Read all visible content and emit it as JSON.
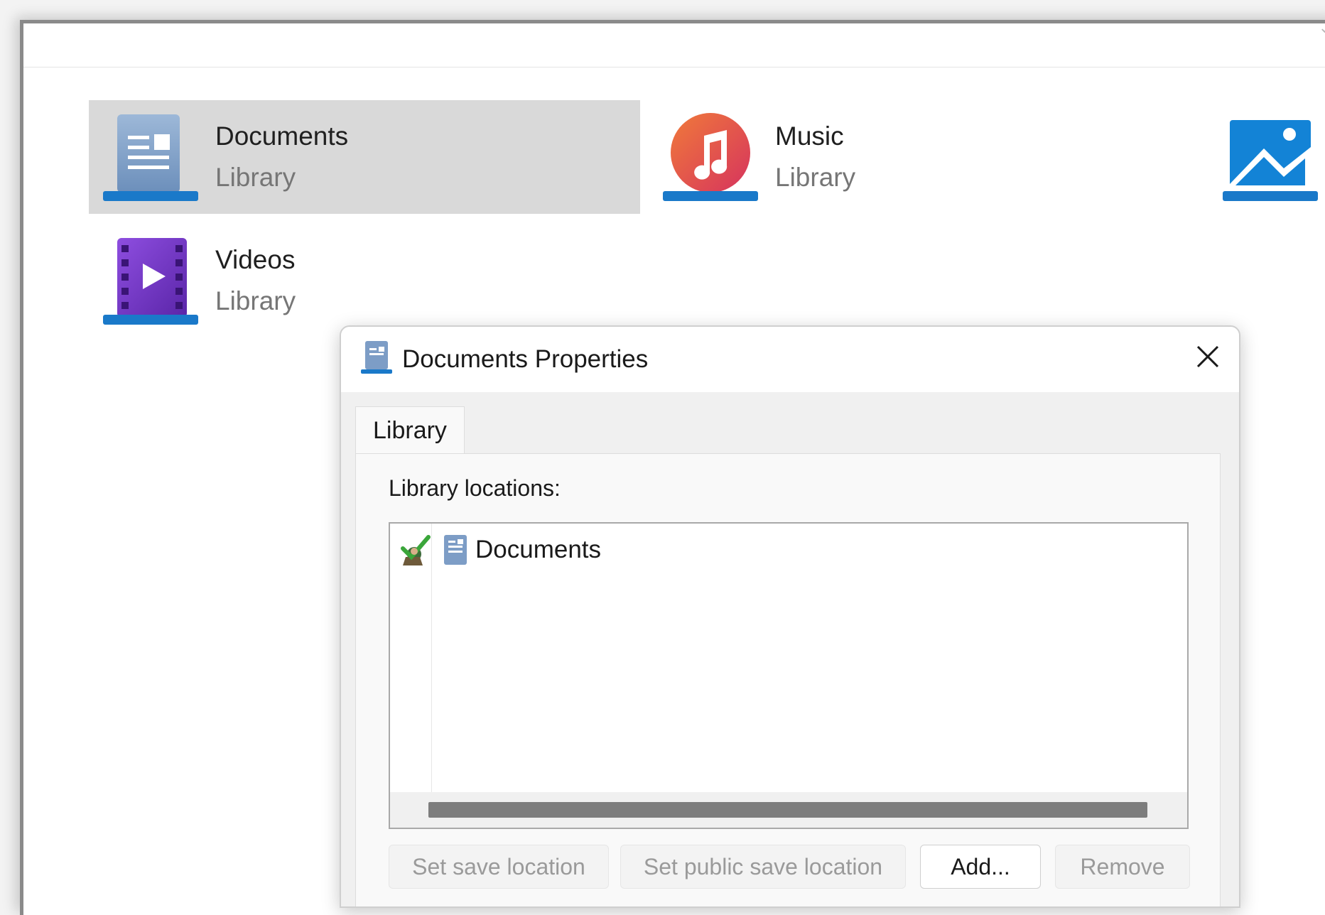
{
  "libraries": [
    {
      "name": "Documents",
      "type": "Library",
      "icon": "documents-library-icon",
      "selected": true
    },
    {
      "name": "Music",
      "type": "Library",
      "icon": "music-library-icon",
      "selected": false
    },
    {
      "name": "",
      "type": "",
      "icon": "pictures-library-icon",
      "selected": false
    },
    {
      "name": "Videos",
      "type": "Library",
      "icon": "videos-library-icon",
      "selected": false
    }
  ],
  "dialog": {
    "title": "Documents Properties",
    "tab_label": "Library",
    "locations_label": "Library locations:",
    "locations": [
      {
        "name": "Documents",
        "status_icon": "default-save-location-check-icon",
        "icon": "documents-folder-icon"
      }
    ],
    "buttons": {
      "set_save": "Set save location",
      "set_public_save": "Set public save location",
      "add": "Add...",
      "remove": "Remove"
    }
  },
  "colors": {
    "selected_tile": "#d9d9d9",
    "accent_blue": "#0f6cbd",
    "music_orange": "#e3552f",
    "video_purple": "#6b2fbf"
  }
}
